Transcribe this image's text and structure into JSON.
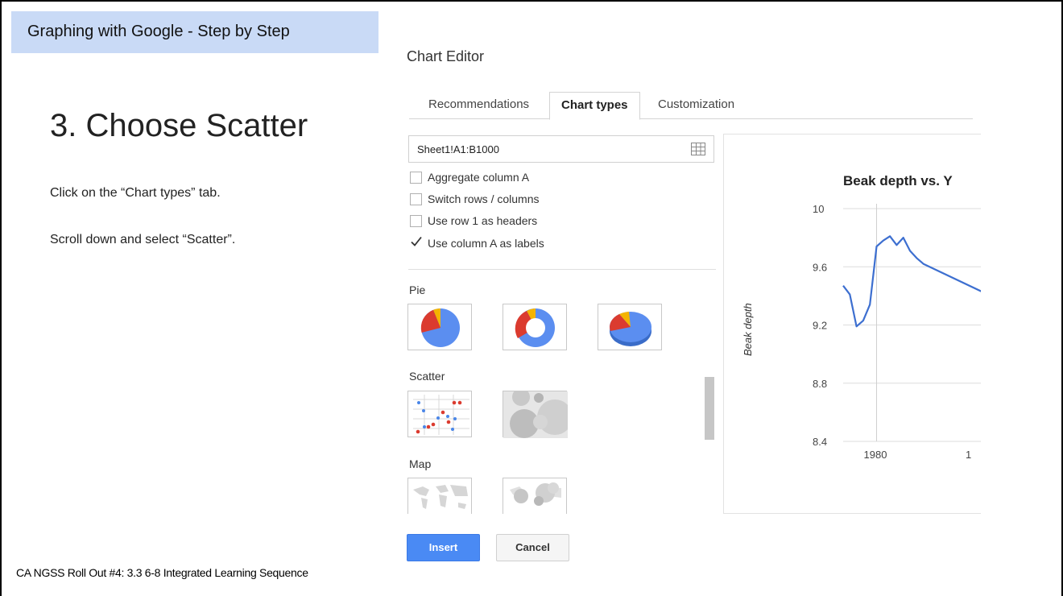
{
  "slide": {
    "banner": "Graphing with Google - Step by Step",
    "step_title": "3. Choose Scatter",
    "instruction_1": "Click on the “Chart types” tab.",
    "instruction_2": "Scroll down and select “Scatter”.",
    "footer": "CA NGSS Roll Out #4: 3.3 6-8 Integrated Learning Sequence"
  },
  "editor": {
    "title": "Chart Editor",
    "tabs": [
      {
        "label": "Recommendations",
        "active": false
      },
      {
        "label": "Chart types",
        "active": true
      },
      {
        "label": "Customization",
        "active": false
      }
    ],
    "data_range": "Sheet1!A1:B1000",
    "options": [
      {
        "label": "Aggregate column A",
        "checked": false
      },
      {
        "label": "Switch rows / columns",
        "checked": false
      },
      {
        "label": "Use row 1 as headers",
        "checked": false
      },
      {
        "label": "Use column A as labels",
        "checked": true
      }
    ],
    "sections": {
      "pie": "Pie",
      "scatter": "Scatter",
      "map": "Map"
    },
    "buttons": {
      "insert": "Insert",
      "cancel": "Cancel"
    },
    "colors": {
      "insert_button": "#4a8af4",
      "pie_blue": "#5b8ef0",
      "pie_red": "#db3b2f",
      "pie_yellow": "#f4b400",
      "line": "#3d6fd0"
    }
  },
  "chart_data": {
    "type": "line",
    "title": "Beak depth vs. Y",
    "ylabel": "Beak depth",
    "xlabel": "",
    "ylim": [
      8.4,
      10
    ],
    "yticks": [
      "10",
      "9.6",
      "9.2",
      "8.8",
      "8.4"
    ],
    "xticks": [
      "1980",
      "1"
    ],
    "grid": true,
    "x": [
      1975,
      1976,
      1977,
      1978,
      1979,
      1980,
      1981,
      1982,
      1983,
      1984,
      1985,
      1986,
      1987
    ],
    "series": [
      {
        "values": [
          9.47,
          9.41,
          9.19,
          9.23,
          9.34,
          9.74,
          9.78,
          9.81,
          9.75,
          9.8,
          9.71,
          9.66,
          9.62
        ]
      }
    ],
    "trailing_value": 9.43
  }
}
